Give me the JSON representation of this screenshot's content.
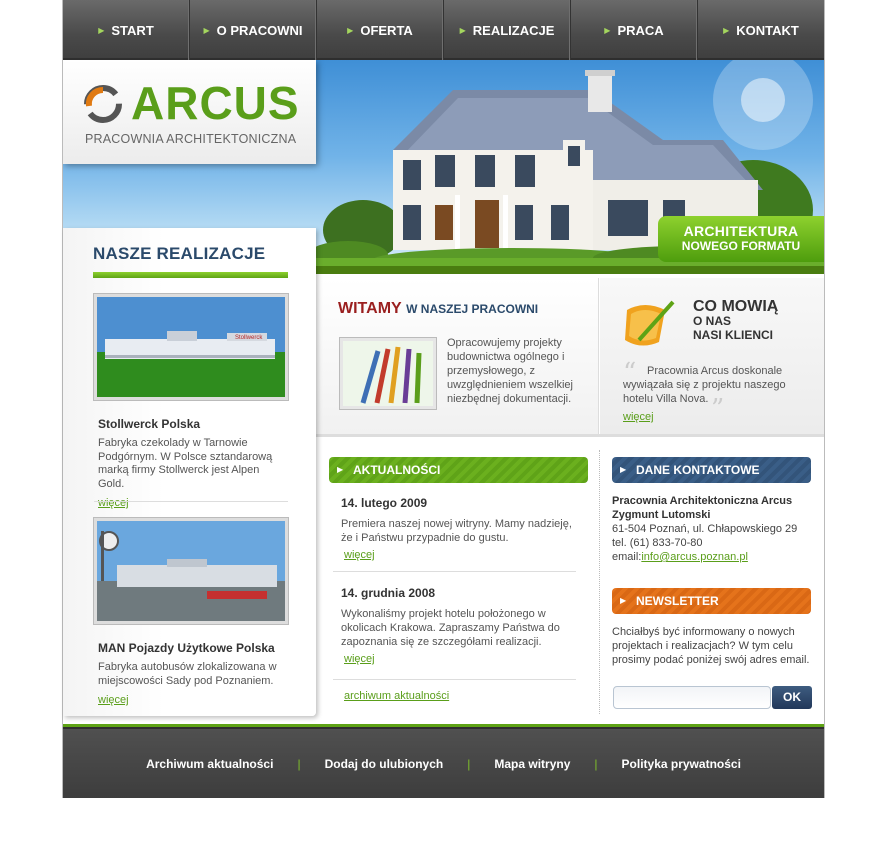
{
  "nav": {
    "items": [
      {
        "label": "START"
      },
      {
        "label": "O PRACOWNI"
      },
      {
        "label": "OFERTA"
      },
      {
        "label": "REALIZACJE"
      },
      {
        "label": "PRACA"
      },
      {
        "label": "KONTAKT"
      }
    ]
  },
  "header": {
    "logo_name": "ARCUS",
    "logo_subtitle": "PRACOWNIA ARCHITEKTONICZNA",
    "badge_line1": "ARCHITEKTURA",
    "badge_line2": "NOWEGO FORMATU"
  },
  "sidebar": {
    "title": "NASZE REALIZACJE",
    "projects": [
      {
        "name": "Stollwerck Polska",
        "description": "Fabryka czekolady w Tarnowie Podgórnym. W Polsce sztandarową marką firmy Stollwerck jest Alpen Gold.",
        "more": "więcej",
        "sign_text": "Stollwerck"
      },
      {
        "name": "MAN Pojazdy Użytkowe Polska",
        "description": "Fabryka autobusów zlokalizowana w miejscowości Sady pod Poznaniem.",
        "more": "więcej"
      }
    ]
  },
  "welcome": {
    "title_strong": "WITAMY",
    "title_rest": "W NASZEJ PRACOWNI",
    "text": "Opracowujemy projekty budownictwa ogólnego i przemysłowego, z uwzględnieniem wszelkiej niezbędnej dokumentacji."
  },
  "testimonial": {
    "title_line1": "CO MOWIĄ",
    "title_line2": "O NAS",
    "title_line3": "NASI KLIENCI",
    "text": "Pracownia Arcus doskonale wywiązała się z projektu naszego hotelu Villa Nova.",
    "more": "więcej",
    "quote_open": "“",
    "quote_close": "”"
  },
  "news": {
    "header": "AKTUALNOŚCI",
    "items": [
      {
        "date": "14. lutego 2009",
        "text": "Premiera naszej nowej witryny. Mamy nadzieję, że i Państwu przypadnie do gustu.",
        "more": "więcej"
      },
      {
        "date": "14. grudnia 2008",
        "text": "Wykonaliśmy projekt hotelu położonego w okolicach Krakowa. Zapraszamy Państwa do zapoznania się ze szczegółami realizacji.",
        "more": "więcej"
      }
    ],
    "archive": "archiwum aktualności"
  },
  "contact": {
    "header": "DANE KONTAKTOWE",
    "company": "Pracownia Architektoniczna Arcus",
    "person": "Zygmunt Lutomski",
    "address": "61-504 Poznań, ul. Chłapowskiego 29",
    "phone": "tel. (61) 833-70-80",
    "email_label": "email:",
    "email": "info@arcus.poznan.pl"
  },
  "newsletter": {
    "header": "NEWSLETTER",
    "text": "Chciałbyś być informowany o nowych projektach i realizacjach? W tym celu prosimy podać poniżej swój adres email.",
    "input_value": "",
    "button": "OK"
  },
  "footer": {
    "links": [
      {
        "label": "Archiwum aktualności"
      },
      {
        "label": "Dodaj do ulubionych"
      },
      {
        "label": "Mapa witryny"
      },
      {
        "label": "Polityka prywatności"
      }
    ],
    "separator": "|"
  },
  "colors": {
    "brand_green": "#5a9e1a",
    "nav_gray": "#4a4a4a",
    "heading_navy": "#2b4a6b",
    "welcome_red": "#9a1f1f",
    "newsletter_orange": "#e5731b"
  }
}
